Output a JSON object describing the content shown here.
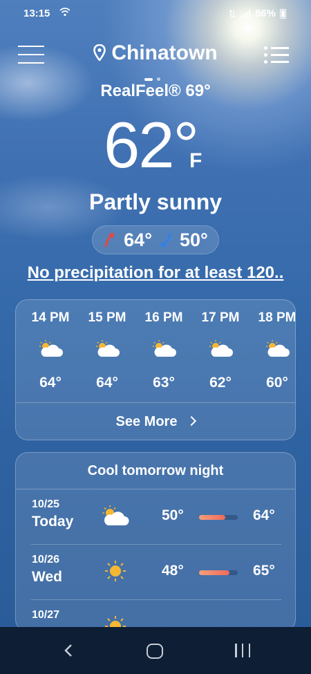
{
  "status": {
    "time": "13:15",
    "battery": "86%"
  },
  "header": {
    "location": "Chinatown"
  },
  "current": {
    "realfeel": "RealFeel® 69°",
    "temperature": "62°",
    "unit": "F",
    "condition": "Partly sunny",
    "high": "64°",
    "low": "50°",
    "precipitation": "No precipitation for at least 120.."
  },
  "hourly": {
    "items": [
      {
        "time": "14 PM",
        "temp": "64°",
        "icon": "partly-sunny-icon"
      },
      {
        "time": "15 PM",
        "temp": "64°",
        "icon": "partly-sunny-icon"
      },
      {
        "time": "16 PM",
        "temp": "63°",
        "icon": "partly-sunny-icon"
      },
      {
        "time": "17 PM",
        "temp": "62°",
        "icon": "partly-sunny-icon"
      },
      {
        "time": "18 PM",
        "temp": "60°",
        "icon": "partly-sunny-icon"
      }
    ],
    "see_more": "See More"
  },
  "daily": {
    "title": "Cool tomorrow night",
    "items": [
      {
        "date": "10/25",
        "day": "Today",
        "low": "50°",
        "high": "64°",
        "icon": "partly-sunny-icon"
      },
      {
        "date": "10/26",
        "day": "Wed",
        "low": "48°",
        "high": "65°",
        "icon": "sunny-icon"
      },
      {
        "date": "10/27",
        "day": "",
        "low": "",
        "high": "",
        "icon": "sunny-icon"
      }
    ]
  },
  "colors": {
    "range_bar_start": "#f5a07a",
    "range_bar_end": "#ee6a5a",
    "nav_bg": "#0e1e34"
  }
}
